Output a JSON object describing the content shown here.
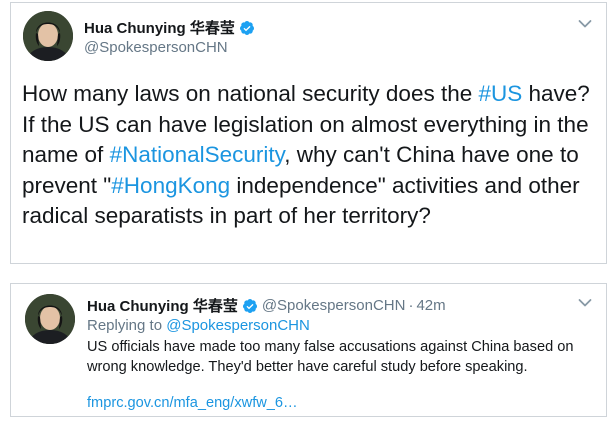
{
  "tweet_main": {
    "author_name": "Hua Chunying 华春莹",
    "handle": "@SpokespersonCHN",
    "verified": true,
    "text_segments": [
      {
        "text": "How many laws on national security does the ",
        "hashtag": false
      },
      {
        "text": "#US",
        "hashtag": true
      },
      {
        "text": " have? If the US can have legislation on almost everything in the name of ",
        "hashtag": false
      },
      {
        "text": "#NationalSecurity",
        "hashtag": true
      },
      {
        "text": ", why can't China have one to prevent \"",
        "hashtag": false
      },
      {
        "text": "#HongKong",
        "hashtag": true
      },
      {
        "text": " independence\" activities and other radical separatists in part of her territory?",
        "hashtag": false
      }
    ]
  },
  "tweet_reply": {
    "author_name": "Hua Chunying 华春莹",
    "handle": "@SpokespersonCHN",
    "separator": "·",
    "time": "42m",
    "replying_label": "Replying to",
    "replying_to": "@SpokespersonCHN",
    "body": "US officials have made too many false accusations against China based on wrong knowledge. They'd better have careful study before speaking.",
    "link": "fmprc.gov.cn/mfa_eng/xwfw_6…"
  },
  "colors": {
    "link": "#1b95e0",
    "secondary_text": "#657786",
    "primary_text": "#14171a",
    "border": "#cfd4d9"
  },
  "icons": [
    "verified-badge-icon",
    "chevron-down-icon"
  ]
}
